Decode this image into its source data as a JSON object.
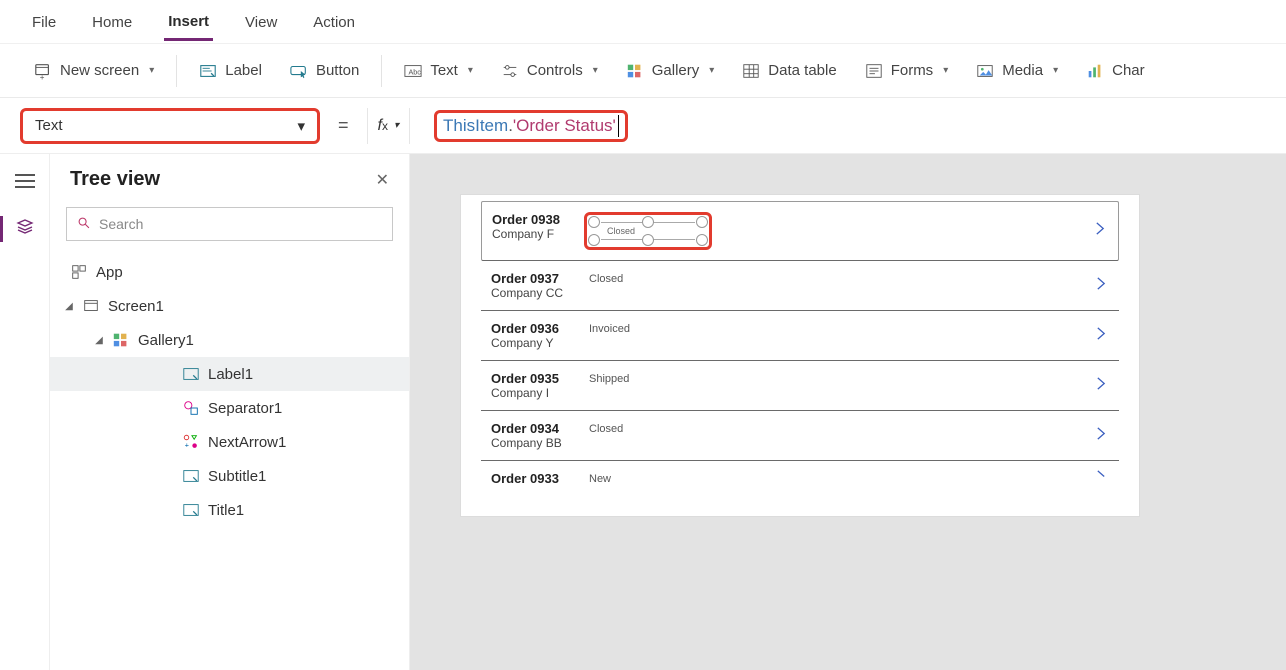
{
  "menu": {
    "file": "File",
    "home": "Home",
    "insert": "Insert",
    "view": "View",
    "action": "Action",
    "active": "Insert"
  },
  "ribbon": {
    "newscreen": "New screen",
    "label": "Label",
    "button": "Button",
    "text": "Text",
    "controls": "Controls",
    "gallery": "Gallery",
    "datatable": "Data table",
    "forms": "Forms",
    "media": "Media",
    "chart": "Char"
  },
  "property": {
    "selected": "Text",
    "formula_token1": "ThisItem",
    "formula_token2": ".",
    "formula_token3": "'Order Status'"
  },
  "tree": {
    "title": "Tree view",
    "search_placeholder": "Search",
    "app": "App",
    "screen": "Screen1",
    "gallery": "Gallery1",
    "items": {
      "label1": "Label1",
      "separator1": "Separator1",
      "nextarrow1": "NextArrow1",
      "subtitle1": "Subtitle1",
      "title1": "Title1"
    },
    "selected": "Label1"
  },
  "gallery_data": [
    {
      "title": "Order 0938",
      "subtitle": "Company F",
      "status": "Closed"
    },
    {
      "title": "Order 0937",
      "subtitle": "Company CC",
      "status": "Closed"
    },
    {
      "title": "Order 0936",
      "subtitle": "Company Y",
      "status": "Invoiced"
    },
    {
      "title": "Order 0935",
      "subtitle": "Company I",
      "status": "Shipped"
    },
    {
      "title": "Order 0934",
      "subtitle": "Company BB",
      "status": "Closed"
    },
    {
      "title": "Order 0933",
      "subtitle": "",
      "status": "New"
    }
  ],
  "colors": {
    "accent": "#742774",
    "highlight": "#e23b2e",
    "arrow": "#3b5fc0"
  }
}
